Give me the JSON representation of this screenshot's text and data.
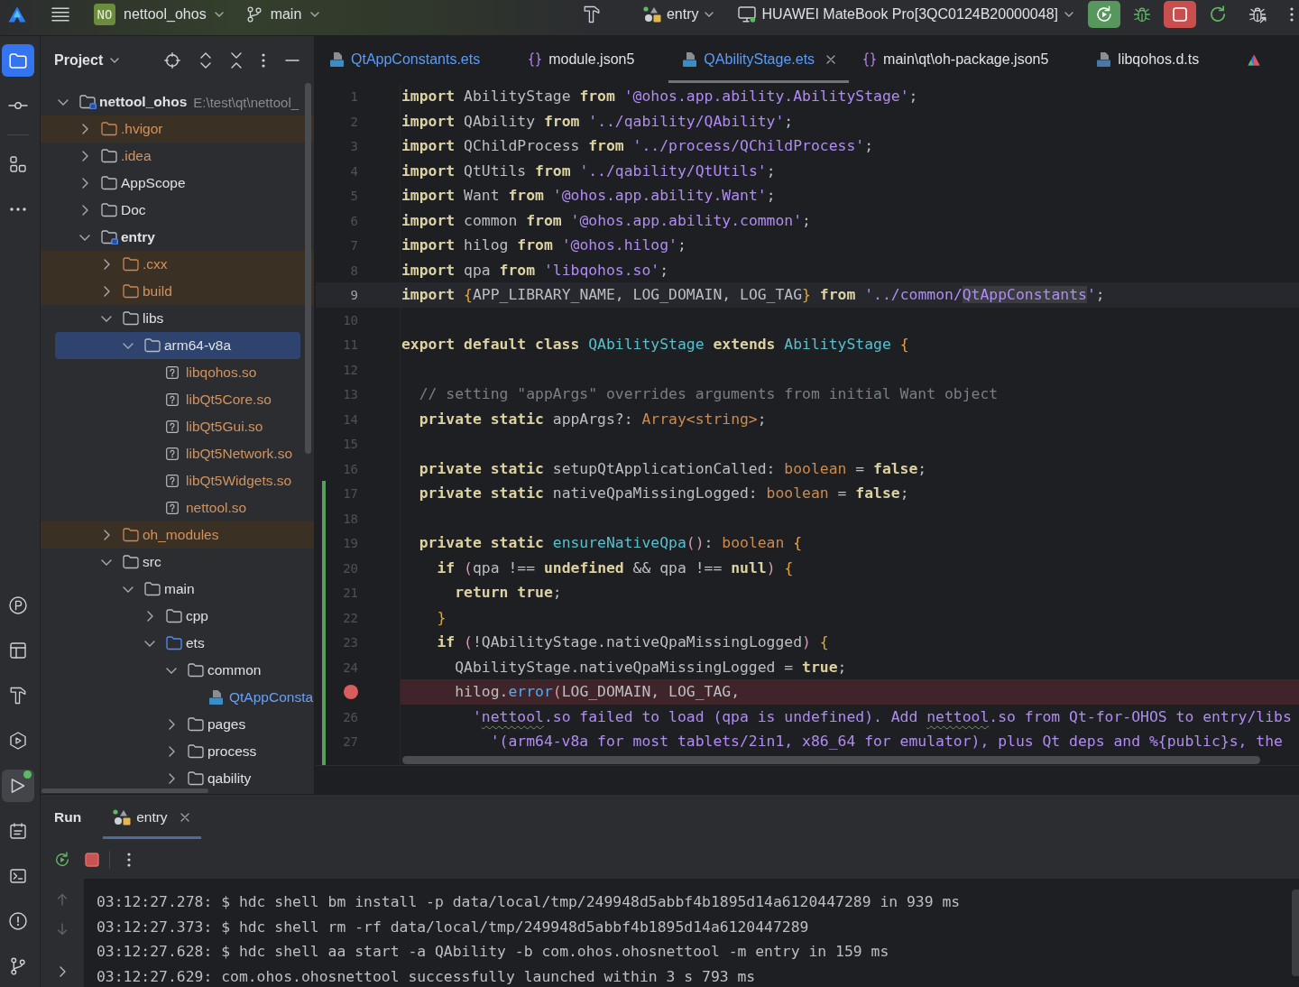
{
  "toolbar": {
    "project_badge": "NO",
    "project": "nettool_ohos",
    "branch": "main",
    "run_config": "entry",
    "device": "HUAWEI MateBook Pro[3QC0124B20000048]"
  },
  "activity_bar": {
    "top": [
      {
        "kind": "project",
        "selected": true,
        "hovered": false,
        "running": false
      },
      {
        "kind": "commit",
        "selected": false,
        "hovered": false,
        "running": false
      },
      {
        "kind": "structure",
        "selected": false,
        "hovered": false,
        "running": false
      },
      {
        "kind": "more",
        "selected": false,
        "hovered": false,
        "running": false
      }
    ],
    "bottom": [
      {
        "kind": "profiler",
        "selected": false,
        "hovered": false,
        "running": false
      },
      {
        "kind": "layout",
        "selected": false,
        "hovered": false,
        "running": false
      },
      {
        "kind": "build",
        "selected": false,
        "hovered": false,
        "running": false
      },
      {
        "kind": "services",
        "selected": false,
        "hovered": false,
        "running": false
      },
      {
        "kind": "run",
        "selected": false,
        "hovered": true,
        "running": true
      },
      {
        "kind": "todo",
        "selected": false,
        "hovered": false,
        "running": false
      },
      {
        "kind": "terminal",
        "selected": false,
        "hovered": false,
        "running": false
      },
      {
        "kind": "problems",
        "selected": false,
        "hovered": false,
        "running": false
      },
      {
        "kind": "git",
        "selected": false,
        "hovered": false,
        "running": false
      }
    ]
  },
  "project_panel": {
    "title": "Project",
    "tree": [
      {
        "label": "nettool_ohos",
        "path": "E:\\test\\qt\\nettool_",
        "kind": "module",
        "expanded": true,
        "selected": false,
        "excluded": false,
        "ignored": false,
        "modified": false,
        "children": [
          {
            "label": ".hvigor",
            "kind": "folder",
            "expanded": false,
            "selected": false,
            "excluded": true,
            "ignored": true,
            "modified": false
          },
          {
            "label": ".idea",
            "kind": "folder",
            "expanded": false,
            "selected": false,
            "excluded": false,
            "ignored": true,
            "modified": false
          },
          {
            "label": "AppScope",
            "kind": "folder",
            "expanded": false,
            "selected": false,
            "excluded": false,
            "ignored": false,
            "modified": false
          },
          {
            "label": "Doc",
            "kind": "folder",
            "expanded": false,
            "selected": false,
            "excluded": false,
            "ignored": false,
            "modified": false
          },
          {
            "label": "entry",
            "kind": "module",
            "expanded": true,
            "selected": false,
            "excluded": false,
            "ignored": false,
            "modified": false,
            "children": [
              {
                "label": ".cxx",
                "kind": "folder",
                "expanded": false,
                "selected": false,
                "excluded": true,
                "ignored": true,
                "modified": false
              },
              {
                "label": "build",
                "kind": "folder",
                "expanded": false,
                "selected": false,
                "excluded": true,
                "ignored": true,
                "modified": false
              },
              {
                "label": "libs",
                "kind": "folder",
                "expanded": true,
                "selected": false,
                "excluded": false,
                "ignored": false,
                "modified": false,
                "children": [
                  {
                    "label": "arm64-v8a",
                    "kind": "folder",
                    "expanded": true,
                    "selected": true,
                    "excluded": false,
                    "ignored": false,
                    "modified": false,
                    "children": [
                      {
                        "label": "libqohos.so",
                        "kind": "file",
                        "selected": false,
                        "excluded": false,
                        "ignored": true,
                        "modified": false
                      },
                      {
                        "label": "libQt5Core.so",
                        "kind": "file",
                        "selected": false,
                        "excluded": false,
                        "ignored": true,
                        "modified": false
                      },
                      {
                        "label": "libQt5Gui.so",
                        "kind": "file",
                        "selected": false,
                        "excluded": false,
                        "ignored": true,
                        "modified": false
                      },
                      {
                        "label": "libQt5Network.so",
                        "kind": "file",
                        "selected": false,
                        "excluded": false,
                        "ignored": true,
                        "modified": false
                      },
                      {
                        "label": "libQt5Widgets.so",
                        "kind": "file",
                        "selected": false,
                        "excluded": false,
                        "ignored": true,
                        "modified": false
                      },
                      {
                        "label": "nettool.so",
                        "kind": "file",
                        "selected": false,
                        "excluded": false,
                        "ignored": true,
                        "modified": false
                      }
                    ]
                  }
                ]
              },
              {
                "label": "oh_modules",
                "kind": "folder",
                "expanded": false,
                "selected": false,
                "excluded": true,
                "ignored": true,
                "modified": false
              },
              {
                "label": "src",
                "kind": "folder",
                "expanded": true,
                "selected": false,
                "excluded": false,
                "ignored": false,
                "modified": false,
                "children": [
                  {
                    "label": "main",
                    "kind": "folder",
                    "expanded": true,
                    "selected": false,
                    "excluded": false,
                    "ignored": false,
                    "modified": false,
                    "children": [
                      {
                        "label": "cpp",
                        "kind": "folder",
                        "expanded": false,
                        "selected": false,
                        "excluded": false,
                        "ignored": false,
                        "modified": false
                      },
                      {
                        "label": "ets",
                        "kind": "source_folder",
                        "expanded": true,
                        "selected": false,
                        "excluded": false,
                        "ignored": false,
                        "modified": false,
                        "children": [
                          {
                            "label": "common",
                            "kind": "folder",
                            "expanded": true,
                            "selected": false,
                            "excluded": false,
                            "ignored": false,
                            "modified": false,
                            "children": [
                              {
                                "label": "QtAppConsta",
                                "kind": "ets_file",
                                "selected": false,
                                "excluded": false,
                                "ignored": false,
                                "modified": true
                              }
                            ]
                          },
                          {
                            "label": "pages",
                            "kind": "folder",
                            "expanded": false,
                            "selected": false,
                            "excluded": false,
                            "ignored": false,
                            "modified": false
                          },
                          {
                            "label": "process",
                            "kind": "folder",
                            "expanded": false,
                            "selected": false,
                            "excluded": false,
                            "ignored": false,
                            "modified": false
                          },
                          {
                            "label": "qability",
                            "kind": "folder",
                            "expanded": false,
                            "selected": false,
                            "excluded": false,
                            "ignored": false,
                            "modified": false
                          }
                        ]
                      }
                    ]
                  }
                ]
              }
            ]
          }
        ]
      }
    ]
  },
  "editor": {
    "tabs": [
      {
        "kind": "ets",
        "label": "QtAppConstants.ets",
        "selected": false,
        "modified": true
      },
      {
        "kind": "json",
        "label": "module.json5",
        "selected": false,
        "modified": false
      },
      {
        "kind": "ets",
        "label": "QAbilityStage.ets",
        "selected": true,
        "modified": true
      },
      {
        "kind": "json",
        "label": "main\\qt\\oh-package.json5",
        "selected": false,
        "modified": false
      },
      {
        "kind": "ts",
        "label": "libqohos.d.ts",
        "selected": false,
        "modified": false
      },
      {
        "kind": "app",
        "selected": false
      }
    ],
    "lines": [
      {
        "number": "1",
        "current": false,
        "breakpoint": false,
        "changed": false,
        "tokens": [
          {
            "kind": "kw",
            "text": "import"
          },
          {
            "kind": "plain",
            "text": " AbilityStage "
          },
          {
            "kind": "kw",
            "text": "from"
          },
          {
            "kind": "str",
            "text": " '@ohos.app.ability.AbilityStage'"
          },
          {
            "kind": "plain",
            "text": ";"
          }
        ]
      },
      {
        "number": "2",
        "current": false,
        "breakpoint": false,
        "changed": false,
        "tokens": [
          {
            "kind": "kw",
            "text": "import"
          },
          {
            "kind": "plain",
            "text": " QAbility "
          },
          {
            "kind": "kw",
            "text": "from"
          },
          {
            "kind": "str",
            "text": " '../qability/QAbility'"
          },
          {
            "kind": "plain",
            "text": ";"
          }
        ]
      },
      {
        "number": "3",
        "current": false,
        "breakpoint": false,
        "changed": false,
        "tokens": [
          {
            "kind": "kw",
            "text": "import"
          },
          {
            "kind": "plain",
            "text": " QChildProcess "
          },
          {
            "kind": "kw",
            "text": "from"
          },
          {
            "kind": "str",
            "text": " '../process/QChildProcess'"
          },
          {
            "kind": "plain",
            "text": ";"
          }
        ]
      },
      {
        "number": "4",
        "current": false,
        "breakpoint": false,
        "changed": false,
        "tokens": [
          {
            "kind": "kw",
            "text": "import"
          },
          {
            "kind": "plain",
            "text": " QtUtils "
          },
          {
            "kind": "kw",
            "text": "from"
          },
          {
            "kind": "str",
            "text": " '../qability/QtUtils'"
          },
          {
            "kind": "plain",
            "text": ";"
          }
        ]
      },
      {
        "number": "5",
        "current": false,
        "breakpoint": false,
        "changed": false,
        "tokens": [
          {
            "kind": "kw",
            "text": "import"
          },
          {
            "kind": "plain",
            "text": " Want "
          },
          {
            "kind": "kw",
            "text": "from"
          },
          {
            "kind": "str",
            "text": " '@ohos.app.ability.Want'"
          },
          {
            "kind": "plain",
            "text": ";"
          }
        ]
      },
      {
        "number": "6",
        "current": false,
        "breakpoint": false,
        "changed": false,
        "tokens": [
          {
            "kind": "kw",
            "text": "import"
          },
          {
            "kind": "plain",
            "text": " common "
          },
          {
            "kind": "kw",
            "text": "from"
          },
          {
            "kind": "str",
            "text": " '@ohos.app.ability.common'"
          },
          {
            "kind": "plain",
            "text": ";"
          }
        ]
      },
      {
        "number": "7",
        "current": false,
        "breakpoint": false,
        "changed": false,
        "tokens": [
          {
            "kind": "kw",
            "text": "import"
          },
          {
            "kind": "plain",
            "text": " hilog "
          },
          {
            "kind": "kw",
            "text": "from"
          },
          {
            "kind": "str",
            "text": " '@ohos.hilog'"
          },
          {
            "kind": "plain",
            "text": ";"
          }
        ]
      },
      {
        "number": "8",
        "current": false,
        "breakpoint": false,
        "changed": false,
        "tokens": [
          {
            "kind": "kw",
            "text": "import"
          },
          {
            "kind": "plain",
            "text": " qpa "
          },
          {
            "kind": "kw",
            "text": "from"
          },
          {
            "kind": "str",
            "text": " 'libqohos.so'"
          },
          {
            "kind": "plain",
            "text": ";"
          }
        ]
      },
      {
        "number": "9",
        "current": true,
        "breakpoint": false,
        "changed": false,
        "tokens": [
          {
            "kind": "kw",
            "text": "import"
          },
          {
            "kind": "brace",
            "text": " {"
          },
          {
            "kind": "plain",
            "text": "APP_LIBRARY_NAME, LOG_DOMAIN, LOG_TAG"
          },
          {
            "kind": "brace",
            "text": "} "
          },
          {
            "kind": "kw",
            "text": "from"
          },
          {
            "kind": "str",
            "text": " '../common/"
          },
          {
            "kind": "ref",
            "text": "QtAppConstants"
          },
          {
            "kind": "str",
            "text": "'"
          },
          {
            "kind": "plain",
            "text": ";"
          }
        ]
      },
      {
        "number": "10",
        "current": false,
        "breakpoint": false,
        "changed": false
      },
      {
        "number": "11",
        "current": false,
        "breakpoint": false,
        "changed": false,
        "tokens": [
          {
            "kind": "kw",
            "text": "export default class"
          },
          {
            "kind": "cls",
            "text": " QAbilityStage "
          },
          {
            "kind": "kw",
            "text": "extends"
          },
          {
            "kind": "cls",
            "text": " AbilityStage "
          },
          {
            "kind": "brace",
            "text": "{"
          }
        ]
      },
      {
        "number": "12",
        "current": false,
        "breakpoint": false,
        "changed": false
      },
      {
        "number": "13",
        "current": false,
        "breakpoint": false,
        "changed": false,
        "tokens": [
          {
            "kind": "cmt",
            "text": "  // setting \"appArgs\" overrides arguments from initial Want object"
          }
        ]
      },
      {
        "number": "14",
        "current": false,
        "breakpoint": false,
        "changed": false,
        "tokens": [
          {
            "kind": "kw",
            "text": "  private static"
          },
          {
            "kind": "plain",
            "text": " appArgs?: "
          },
          {
            "kind": "type",
            "text": "Array<string>"
          },
          {
            "kind": "plain",
            "text": ";"
          }
        ]
      },
      {
        "number": "15",
        "current": false,
        "breakpoint": false,
        "changed": false
      },
      {
        "number": "16",
        "current": false,
        "breakpoint": false,
        "changed": false,
        "tokens": [
          {
            "kind": "kw",
            "text": "  private static"
          },
          {
            "kind": "plain",
            "text": " setupQtApplicationCalled: "
          },
          {
            "kind": "type",
            "text": "boolean"
          },
          {
            "kind": "plain",
            "text": " = "
          },
          {
            "kind": "kw",
            "text": "false"
          },
          {
            "kind": "plain",
            "text": ";"
          }
        ]
      },
      {
        "number": "17",
        "current": false,
        "breakpoint": false,
        "changed": true,
        "tokens": [
          {
            "kind": "kw",
            "text": "  private static"
          },
          {
            "kind": "plain",
            "text": " nativeQpaMissingLogged: "
          },
          {
            "kind": "type",
            "text": "boolean"
          },
          {
            "kind": "plain",
            "text": " = "
          },
          {
            "kind": "kw",
            "text": "false"
          },
          {
            "kind": "plain",
            "text": ";"
          }
        ]
      },
      {
        "number": "18",
        "current": false,
        "breakpoint": false,
        "changed": true
      },
      {
        "number": "19",
        "current": false,
        "breakpoint": false,
        "changed": true,
        "tokens": [
          {
            "kind": "kw",
            "text": "  private static"
          },
          {
            "kind": "fn",
            "text": " ensureNativeQpa"
          },
          {
            "kind": "paren",
            "text": "()"
          },
          {
            "kind": "plain",
            "text": ": "
          },
          {
            "kind": "type",
            "text": "boolean"
          },
          {
            "kind": "brace",
            "text": " {"
          }
        ]
      },
      {
        "number": "20",
        "current": false,
        "breakpoint": false,
        "changed": true,
        "tokens": [
          {
            "kind": "kw",
            "text": "    if"
          },
          {
            "kind": "paren",
            "text": " ("
          },
          {
            "kind": "plain",
            "text": "qpa !== "
          },
          {
            "kind": "kw",
            "text": "undefined"
          },
          {
            "kind": "plain",
            "text": " && qpa !== "
          },
          {
            "kind": "kw",
            "text": "null"
          },
          {
            "kind": "paren",
            "text": ")"
          },
          {
            "kind": "brace",
            "text": " {"
          }
        ]
      },
      {
        "number": "21",
        "current": false,
        "breakpoint": false,
        "changed": true,
        "tokens": [
          {
            "kind": "kw",
            "text": "      return true"
          },
          {
            "kind": "plain",
            "text": ";"
          }
        ]
      },
      {
        "number": "22",
        "current": false,
        "breakpoint": false,
        "changed": true,
        "tokens": [
          {
            "kind": "brace",
            "text": "    }"
          }
        ]
      },
      {
        "number": "23",
        "current": false,
        "breakpoint": false,
        "changed": true,
        "tokens": [
          {
            "kind": "kw",
            "text": "    if"
          },
          {
            "kind": "paren",
            "text": " ("
          },
          {
            "kind": "plain",
            "text": "!QAbilityStage.nativeQpaMissingLogged"
          },
          {
            "kind": "paren",
            "text": ")"
          },
          {
            "kind": "brace",
            "text": " {"
          }
        ]
      },
      {
        "number": "24",
        "current": false,
        "breakpoint": false,
        "changed": true,
        "tokens": [
          {
            "kind": "plain",
            "text": "      QAbilityStage.nativeQpaMissingLogged = "
          },
          {
            "kind": "kw",
            "text": "true"
          },
          {
            "kind": "plain",
            "text": ";"
          }
        ]
      },
      {
        "current": false,
        "breakpoint": true,
        "changed": true,
        "tokens": [
          {
            "kind": "plain",
            "text": "      hilog."
          },
          {
            "kind": "call",
            "text": "error"
          },
          {
            "kind": "paren",
            "text": "("
          },
          {
            "kind": "plain",
            "text": "LOG_DOMAIN, LOG_TAG,"
          }
        ]
      },
      {
        "number": "26",
        "current": false,
        "breakpoint": false,
        "changed": true,
        "tokens": [
          {
            "kind": "str",
            "text": "        '"
          },
          {
            "kind": "typo",
            "text": "nettool"
          },
          {
            "kind": "str",
            "text": ".so failed to load (qpa is undefined). Add "
          },
          {
            "kind": "typo",
            "text": "nettool"
          },
          {
            "kind": "str",
            "text": ".so from Qt-for-OHOS to entry/libs"
          }
        ]
      },
      {
        "number": "27",
        "current": false,
        "breakpoint": false,
        "changed": true,
        "tokens": [
          {
            "kind": "str",
            "text": "          '(arm64-v8a for most tablets/2in1, x86_64 for emulator), plus Qt deps and %{public}s, the"
          }
        ]
      },
      {
        "current": false,
        "breakpoint": false,
        "changed": true
      }
    ]
  },
  "run_panel": {
    "title": "Run",
    "tabs": [
      {
        "label": "entry",
        "selected": true
      }
    ],
    "log": [
      "03:12:27.278: $ hdc shell bm install -p data/local/tmp/249948d5abbf4b1895d14a6120447289 in 939 ms",
      "03:12:27.373: $ hdc shell rm -rf data/local/tmp/249948d5abbf4b1895d14a6120447289",
      "03:12:27.628: $ hdc shell aa start -a QAbility -b com.ohos.ohosnettool -m entry in 159 ms",
      "03:12:27.629: com.ohos.ohosnettool successfully launched within 3 s 793 ms"
    ]
  }
}
